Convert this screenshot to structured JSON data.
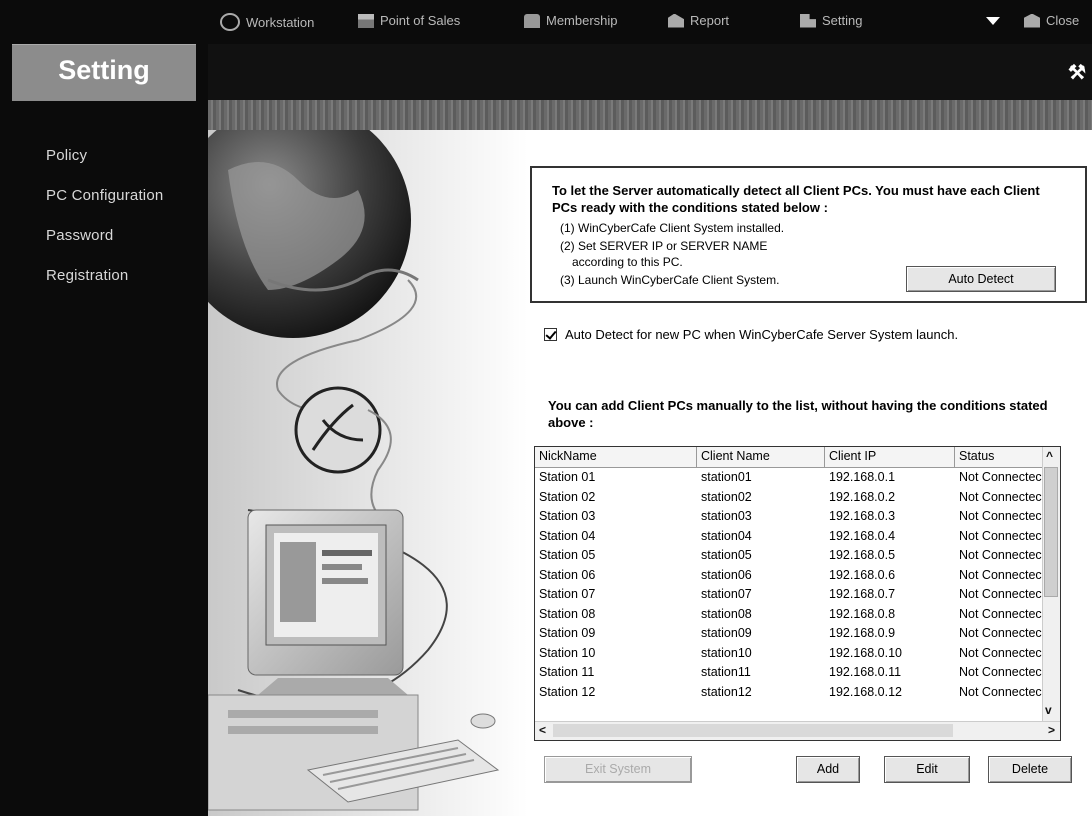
{
  "sidebar": {
    "title": "Setting",
    "items": [
      {
        "label": "Policy"
      },
      {
        "label": "PC Configuration"
      },
      {
        "label": "Password"
      },
      {
        "label": "Registration"
      }
    ]
  },
  "topnav": {
    "items": [
      {
        "label": "Workstation",
        "icon": "workstation-icon"
      },
      {
        "label": "Point of Sales",
        "icon": "point-of-sales-icon"
      },
      {
        "label": "Membership",
        "icon": "membership-icon"
      },
      {
        "label": "Report",
        "icon": "report-icon"
      },
      {
        "label": "Setting",
        "icon": "setting-icon"
      },
      {
        "label": "Close",
        "icon": "close-icon"
      }
    ]
  },
  "auto_detect": {
    "title": "To let the Server automatically detect all Client PCs. You must have each Client PCs ready with the conditions stated below :",
    "conditions": [
      "(1) WinCyberCafe Client System installed.",
      "(2) Set SERVER IP or SERVER NAME",
      "according to this PC.",
      "(3) Launch WinCyberCafe Client System."
    ],
    "button_label": "Auto Detect",
    "checkbox_label": "Auto Detect for new PC when WinCyberCafe Server System launch.",
    "checkbox_checked": true
  },
  "manual": {
    "title": "You can add Client PCs manually to the list, without having the conditions stated above :"
  },
  "client_table": {
    "columns": [
      "NickName",
      "Client Name",
      "Client IP",
      "Status"
    ],
    "rows": [
      [
        "Station 01",
        "station01",
        "192.168.0.1",
        "Not Connectec"
      ],
      [
        "Station 02",
        "station02",
        "192.168.0.2",
        "Not Connectec"
      ],
      [
        "Station 03",
        "station03",
        "192.168.0.3",
        "Not Connectec"
      ],
      [
        "Station 04",
        "station04",
        "192.168.0.4",
        "Not Connectec"
      ],
      [
        "Station 05",
        "station05",
        "192.168.0.5",
        "Not Connectec"
      ],
      [
        "Station 06",
        "station06",
        "192.168.0.6",
        "Not Connectec"
      ],
      [
        "Station 07",
        "station07",
        "192.168.0.7",
        "Not Connectec"
      ],
      [
        "Station 08",
        "station08",
        "192.168.0.8",
        "Not Connectec"
      ],
      [
        "Station 09",
        "station09",
        "192.168.0.9",
        "Not Connectec"
      ],
      [
        "Station 10",
        "station10",
        "192.168.0.10",
        "Not Connectec"
      ],
      [
        "Station 11",
        "station11",
        "192.168.0.11",
        "Not Connectec"
      ],
      [
        "Station 12",
        "station12",
        "192.168.0.12",
        "Not Connectec"
      ]
    ]
  },
  "actions": {
    "exit_label": "Exit System",
    "add_label": "Add",
    "edit_label": "Edit",
    "delete_label": "Delete"
  }
}
